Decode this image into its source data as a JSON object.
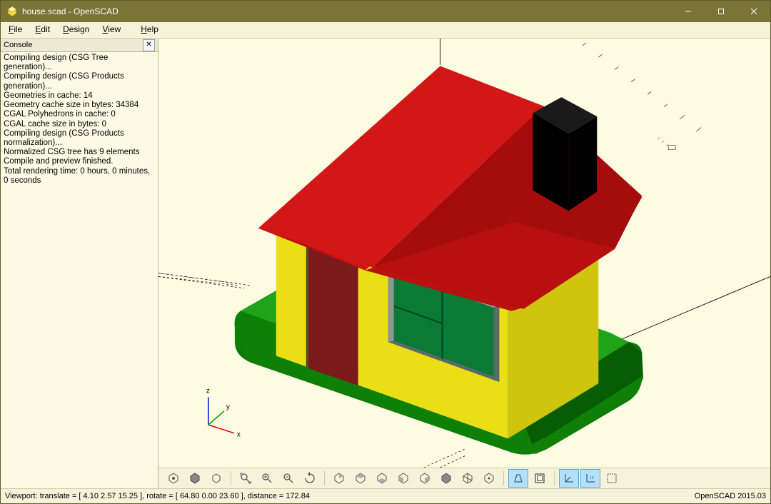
{
  "window": {
    "title": "house.scad - OpenSCAD"
  },
  "menu": {
    "file": "File",
    "edit": "Edit",
    "design": "Design",
    "view": "View",
    "help": "Help"
  },
  "console": {
    "title": "Console",
    "lines": "Compiling design (CSG Tree generation)...\nCompiling design (CSG Products generation)...\nGeometries in cache: 14\nGeometry cache size in bytes: 34384\nCGAL Polyhedrons in cache: 0\nCGAL cache size in bytes: 0\nCompiling design (CSG Products normalization)...\nNormalized CSG tree has 9 elements\nCompile and preview finished.\nTotal rendering time: 0 hours, 0 minutes, 0 seconds"
  },
  "axes": {
    "x": "x",
    "y": "y",
    "z": "z"
  },
  "status": {
    "left": "Viewport: translate = [ 4.10 2.57 15.25 ], rotate = [ 64.80 0.00 23.60 ], distance = 172.84",
    "right": "OpenSCAD 2015.03"
  },
  "toolbar_state": {
    "show_axes": true,
    "show_scale": true,
    "surfaces": true
  }
}
